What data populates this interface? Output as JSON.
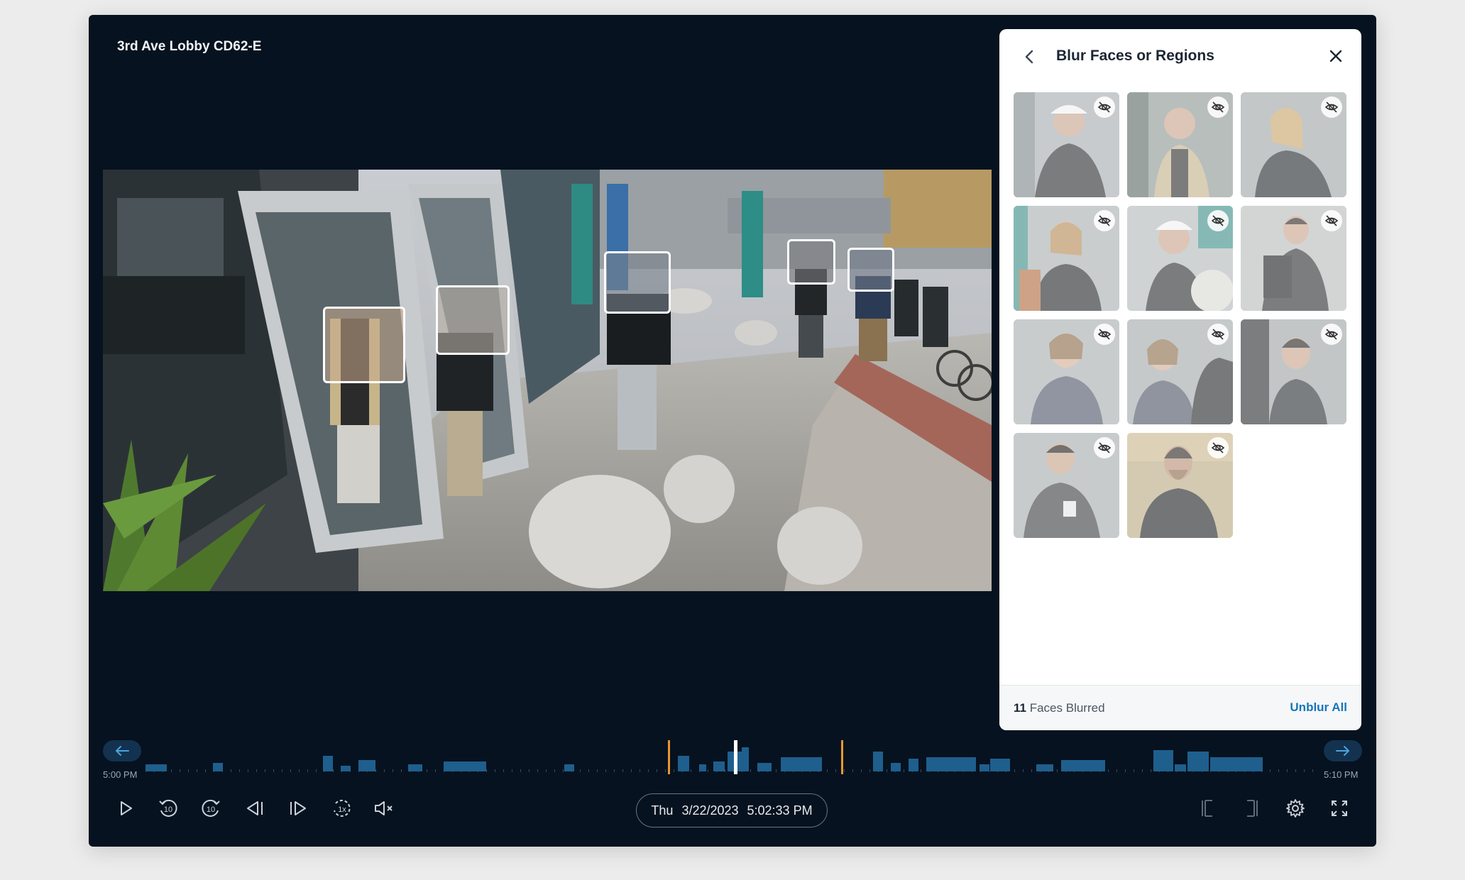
{
  "camera": {
    "title": "3rd Ave Lobby CD62-E"
  },
  "panel": {
    "title": "Blur Faces or Regions",
    "thumbnails": [
      {
        "subject": "man-white-cap",
        "icon": "eye-off-icon"
      },
      {
        "subject": "man-beige-jacket",
        "icon": "eye-off-icon"
      },
      {
        "subject": "woman-blonde",
        "icon": "eye-off-icon"
      },
      {
        "subject": "woman-backpack",
        "icon": "eye-off-icon"
      },
      {
        "subject": "man-white-cap-2",
        "icon": "eye-off-icon"
      },
      {
        "subject": "man-backpack",
        "icon": "eye-off-icon"
      },
      {
        "subject": "woman-vest",
        "icon": "eye-off-icon"
      },
      {
        "subject": "woman-phone",
        "icon": "eye-off-icon"
      },
      {
        "subject": "man-dark-hoodie",
        "icon": "eye-off-icon"
      },
      {
        "subject": "man-phone",
        "icon": "eye-off-icon"
      },
      {
        "subject": "man-beard-beanie",
        "icon": "eye-off-icon"
      }
    ],
    "footer": {
      "count": "11",
      "count_label": "Faces Blurred",
      "action": "Unblur All"
    }
  },
  "timeline": {
    "start_label": "5:00 PM",
    "end_label": "5:10 PM"
  },
  "controls": {
    "day": "Thu",
    "date": "3/22/2023",
    "time": "5:02:33 PM",
    "skip_back": "10",
    "skip_forward": "10",
    "speed": "1x"
  },
  "colors": {
    "accent": "#1676b8",
    "timeline_bar": "#1f5f8d",
    "clip_marker": "#e8972f",
    "background": "#06121f"
  }
}
